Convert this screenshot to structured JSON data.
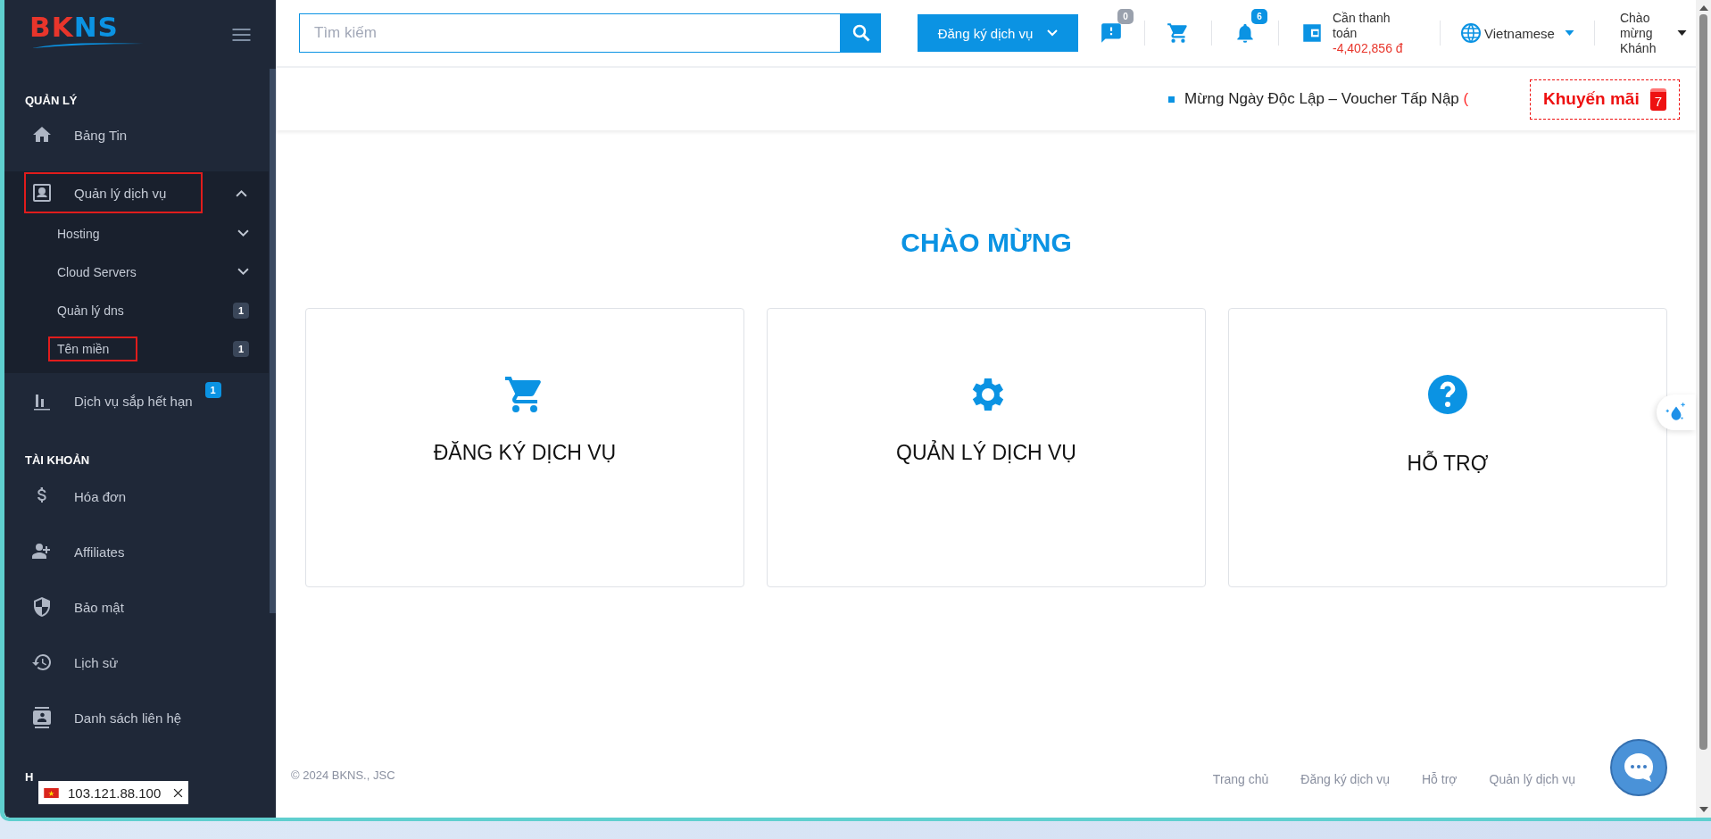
{
  "logo": [
    {
      "text": "BK",
      "color": "#e8352b"
    },
    {
      "text": "NS",
      "color": "#0b93e3"
    }
  ],
  "sidebar": {
    "entries": [
      {
        "kind": "heading",
        "label": "QUẢN LÝ"
      },
      {
        "kind": "item",
        "label": "Bảng Tin",
        "annotated": false
      },
      {
        "kind": "item",
        "label": "Quản lý dịch vụ",
        "annotated": true,
        "expanded": true,
        "children": [
          {
            "label": "Hosting",
            "expanded": false,
            "annotated": false
          },
          {
            "label": "Cloud Servers",
            "expanded": false,
            "annotated": false
          },
          {
            "label": "Quản lý dns",
            "badge": "1",
            "annotated": false
          },
          {
            "label": "Tên miền",
            "badge": "1",
            "annotated": true
          }
        ]
      },
      {
        "kind": "item",
        "label": "Dịch vụ sắp hết hạn",
        "badge": "1",
        "annotated": false
      },
      {
        "kind": "heading",
        "label": "TÀI KHOẢN"
      },
      {
        "kind": "item",
        "label": "Hóa đơn",
        "annotated": false
      },
      {
        "kind": "item",
        "label": "Affiliates",
        "annotated": false
      },
      {
        "kind": "item",
        "label": "Bảo mật",
        "annotated": false
      },
      {
        "kind": "item",
        "label": "Lịch sử",
        "annotated": false
      },
      {
        "kind": "item",
        "label": "Danh sách liên hệ",
        "annotated": false
      },
      {
        "kind": "heading",
        "label": "H"
      }
    ]
  },
  "ip_chip": {
    "text": "103.121.88.100"
  },
  "topbar": {
    "search": {
      "placeholder": "Tìm kiếm"
    },
    "register_button": "Đăng ký dịch vụ",
    "icons": [
      {
        "kind": "ticket",
        "badge": "0",
        "color": "#9aa1ad"
      },
      {
        "kind": "cart"
      },
      {
        "kind": "bell",
        "badge": "6",
        "color": "#0b93e3"
      }
    ],
    "balance": {
      "label": "Cần thanh toán",
      "amount": "-4,402,856 đ"
    },
    "language": "Vietnamese",
    "greeting": "Chào mừng Khánh"
  },
  "promo": {
    "ticker": "Mừng Ngày Độc Lập – Voucher Tấp Nập",
    "ticker_tail": "(",
    "button": "Khuyến mãi",
    "count": "7"
  },
  "welcome": "CHÀO MỪNG",
  "cards": [
    {
      "title": "ĐĂNG KÝ DỊCH VỤ"
    },
    {
      "title": "QUẢN LÝ DỊCH VỤ"
    },
    {
      "title": "HỖ TRỢ"
    }
  ],
  "footer": {
    "copyright": "© 2024 BKNS., JSC",
    "links": [
      "Trang chủ",
      "Đăng ký dịch vụ",
      "Hỗ trợ",
      "Quản lý dịch vụ"
    ]
  }
}
